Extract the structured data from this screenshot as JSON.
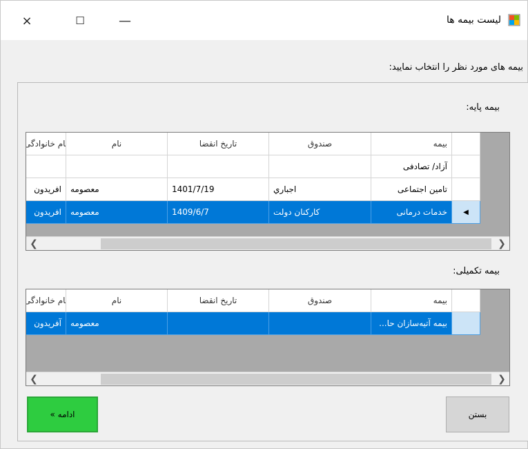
{
  "window": {
    "title": "لیست بیمه ها",
    "controls": {
      "close": "×",
      "maximize": "☐",
      "minimize": "—"
    }
  },
  "instruction": "بیمه های مورد نظر را انتخاب نمایید:",
  "base_insurance": {
    "label": "بیمه پایه:",
    "headers": {
      "insurance": "بیمه",
      "fund": "صندوق",
      "expiry": "تاریخ انقضا",
      "name": "نام",
      "family": "نام خانوادگی"
    },
    "rows": [
      {
        "insurance": "آزاد/ تصادفی",
        "fund": "",
        "expiry": "",
        "name": "",
        "family": "",
        "selected": false
      },
      {
        "insurance": "تامین اجتماعی",
        "fund": "اجباري",
        "expiry": "1401/7/19",
        "name": "معصومه",
        "family": "افريدون",
        "selected": false
      },
      {
        "insurance": "خدمات درمانی",
        "fund": "کارکنان دولت",
        "expiry": "1409/6/7",
        "name": "معصومه",
        "family": "افريدون",
        "selected": true
      }
    ]
  },
  "supplementary_insurance": {
    "label": "بیمه تکمیلی:",
    "headers": {
      "insurance": "بیمه",
      "fund": "صندوق",
      "expiry": "تاریخ انقضا",
      "name": "نام",
      "family": "نام خانوادگی"
    },
    "rows": [
      {
        "insurance": "بیمه آتیه‌سازان حا...",
        "fund": "",
        "expiry": "",
        "name": "معصومه",
        "family": "آفريدون",
        "selected": true
      }
    ]
  },
  "buttons": {
    "continue": "ادامه »",
    "close": "بستن"
  },
  "colors": {
    "selection": "#0078d7",
    "continue_button": "#2ecc40",
    "grid_background": "#a9a9a9"
  }
}
